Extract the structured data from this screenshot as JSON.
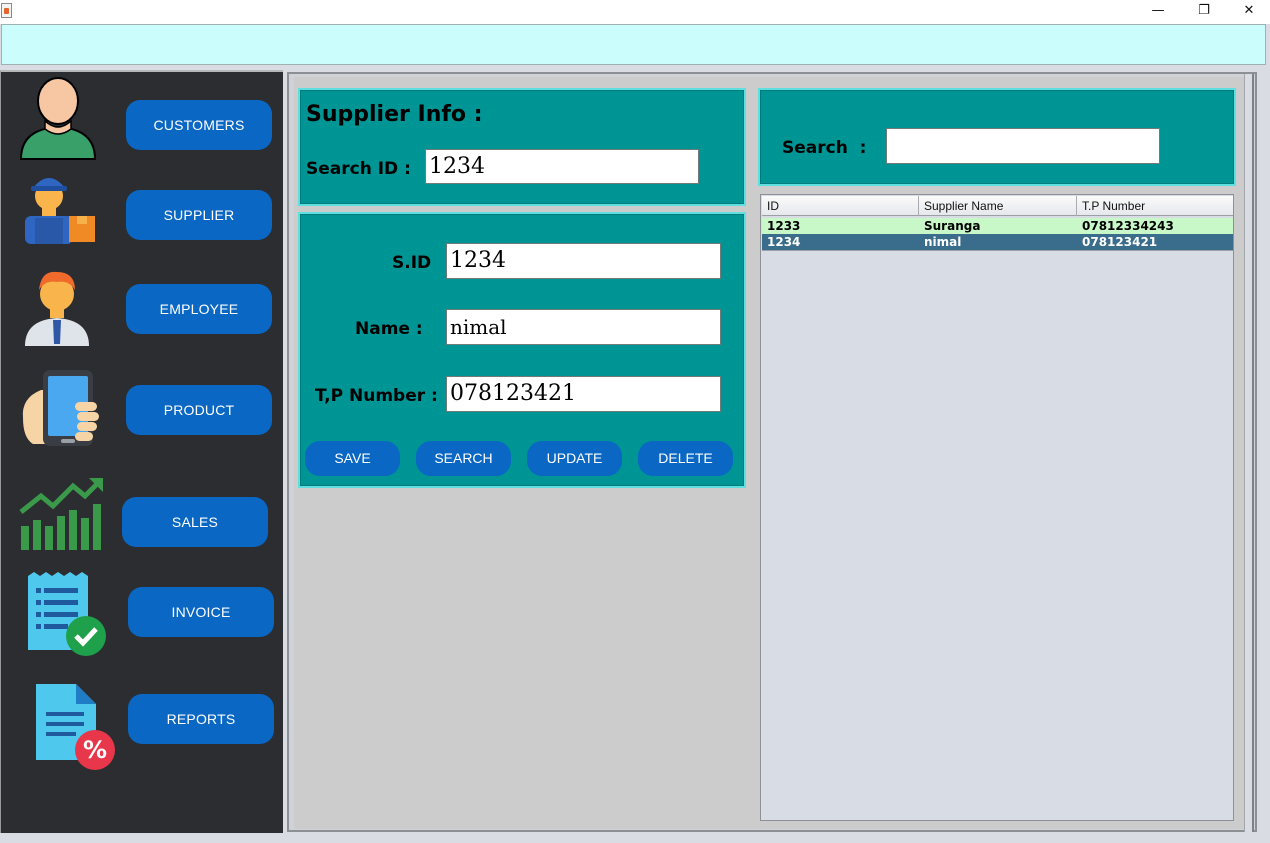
{
  "window": {
    "minimize_glyph": "—",
    "maximize_glyph": "❐",
    "close_glyph": "✕"
  },
  "sidebar": {
    "items": [
      {
        "label": "CUSTOMERS",
        "icon": "customer-avatar-icon"
      },
      {
        "label": "SUPPLIER",
        "icon": "delivery-worker-icon"
      },
      {
        "label": "EMPLOYEE",
        "icon": "employee-avatar-icon"
      },
      {
        "label": "PRODUCT",
        "icon": "mobile-phone-icon"
      },
      {
        "label": "SALES",
        "icon": "sales-growth-chart-icon"
      },
      {
        "label": "INVOICE",
        "icon": "invoice-check-icon"
      },
      {
        "label": "REPORTS",
        "icon": "report-percent-icon"
      }
    ]
  },
  "supplier_info": {
    "title": "Supplier Info :",
    "search_id_label": "Search ID :",
    "search_id_value": "1234"
  },
  "form": {
    "sid_label": "S.ID",
    "sid_value": "1234",
    "name_label": "Name :",
    "name_value": "nimal",
    "tp_label": "T,P Number :",
    "tp_value": "078123421"
  },
  "actions": {
    "save": "SAVE",
    "search": "SEARCH",
    "update": "UPDATE",
    "delete": "DELETE"
  },
  "table_search": {
    "label": "Search  :",
    "value": ""
  },
  "table": {
    "columns": [
      "ID",
      "Supplier Name",
      "T.P Number"
    ],
    "rows": [
      {
        "id": "1233",
        "name": "Suranga",
        "tp": "07812334243",
        "state": "normal"
      },
      {
        "id": "1234",
        "name": "nimal",
        "tp": "078123421",
        "state": "selected"
      }
    ]
  },
  "colors": {
    "accent_button": "#0a67c4",
    "panel_teal": "#009595",
    "header_strip": "#cbfdfd",
    "sidebar_bg": "#2b2d30",
    "row_normal": "#c8f7c8",
    "row_selected": "#3a6d8c"
  }
}
